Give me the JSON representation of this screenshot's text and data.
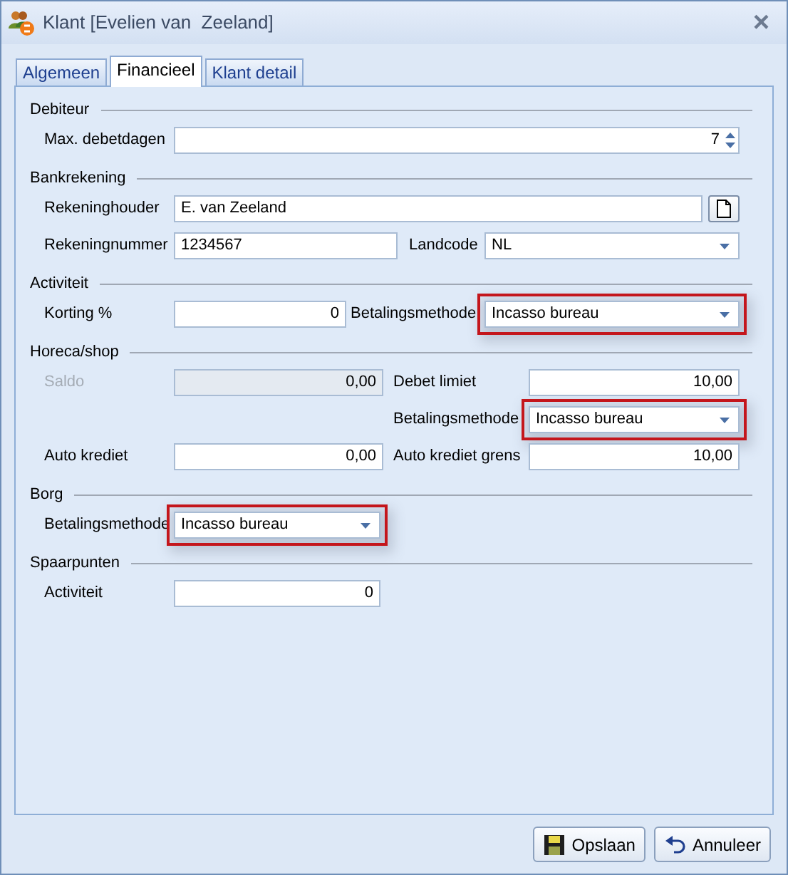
{
  "window": {
    "title": "Klant [Evelien van  Zeeland]",
    "close": "×"
  },
  "tabs": [
    {
      "label": "Algemeen",
      "selected": false
    },
    {
      "label": "Financieel",
      "selected": true
    },
    {
      "label": "Klant detail",
      "selected": false
    }
  ],
  "sections": [
    {
      "title": "Debiteur",
      "rows": [
        [
          {
            "kind": "label",
            "text": "Max. debetdagen",
            "disabled": false
          },
          {
            "kind": "spin",
            "value": "7",
            "disabled": false
          }
        ]
      ]
    },
    {
      "title": "Bankrekening",
      "rows": [
        [
          {
            "kind": "label",
            "text": "Rekeninghouder",
            "disabled": false
          },
          {
            "kind": "text",
            "value": "E. van Zeeland",
            "disabled": false
          },
          {
            "kind": "browse"
          }
        ],
        [
          {
            "kind": "label",
            "text": "Rekeningnummer",
            "disabled": false
          },
          {
            "kind": "text",
            "value": "1234567",
            "disabled": false
          },
          {
            "kind": "label",
            "text": "Landcode",
            "disabled": false
          },
          {
            "kind": "combo",
            "value": "NL",
            "highlighted": false
          }
        ]
      ]
    },
    {
      "title": "Activiteit",
      "rows": [
        [
          {
            "kind": "label",
            "text": "Korting %",
            "disabled": false
          },
          {
            "kind": "number",
            "value": "0",
            "disabled": false
          },
          {
            "kind": "label",
            "text": "Betalingsmethode",
            "disabled": false
          },
          {
            "kind": "combo",
            "value": "Incasso bureau",
            "highlighted": true
          }
        ]
      ]
    },
    {
      "title": "Horeca/shop",
      "rows": [
        [
          {
            "kind": "label",
            "text": "Saldo",
            "disabled": true
          },
          {
            "kind": "number",
            "value": "0,00",
            "disabled": true
          },
          {
            "kind": "label",
            "text": "Debet limiet",
            "disabled": false
          },
          {
            "kind": "number",
            "value": "10,00",
            "disabled": false
          }
        ],
        [
          {
            "kind": "empty"
          },
          {
            "kind": "empty"
          },
          {
            "kind": "label",
            "text": "Betalingsmethode",
            "disabled": false
          },
          {
            "kind": "combo",
            "value": "Incasso bureau",
            "highlighted": true
          }
        ],
        [
          {
            "kind": "label",
            "text": "Auto krediet",
            "disabled": false
          },
          {
            "kind": "number",
            "value": "0,00",
            "disabled": false
          },
          {
            "kind": "label",
            "text": "Auto krediet grens",
            "disabled": false
          },
          {
            "kind": "number",
            "value": "10,00",
            "disabled": false
          }
        ]
      ]
    },
    {
      "title": "Borg",
      "rows": [
        [
          {
            "kind": "label",
            "text": "Betalingsmethode",
            "disabled": false
          },
          {
            "kind": "combo",
            "value": "Incasso bureau",
            "highlighted": true
          }
        ]
      ]
    },
    {
      "title": "Spaarpunten",
      "rows": [
        [
          {
            "kind": "label",
            "text": "Activiteit",
            "disabled": false
          },
          {
            "kind": "number",
            "value": "0",
            "disabled": false
          }
        ]
      ]
    }
  ],
  "buttons": [
    {
      "kind": "save",
      "label": "Opslaan"
    },
    {
      "kind": "cancel",
      "label": "Annuleer"
    }
  ]
}
